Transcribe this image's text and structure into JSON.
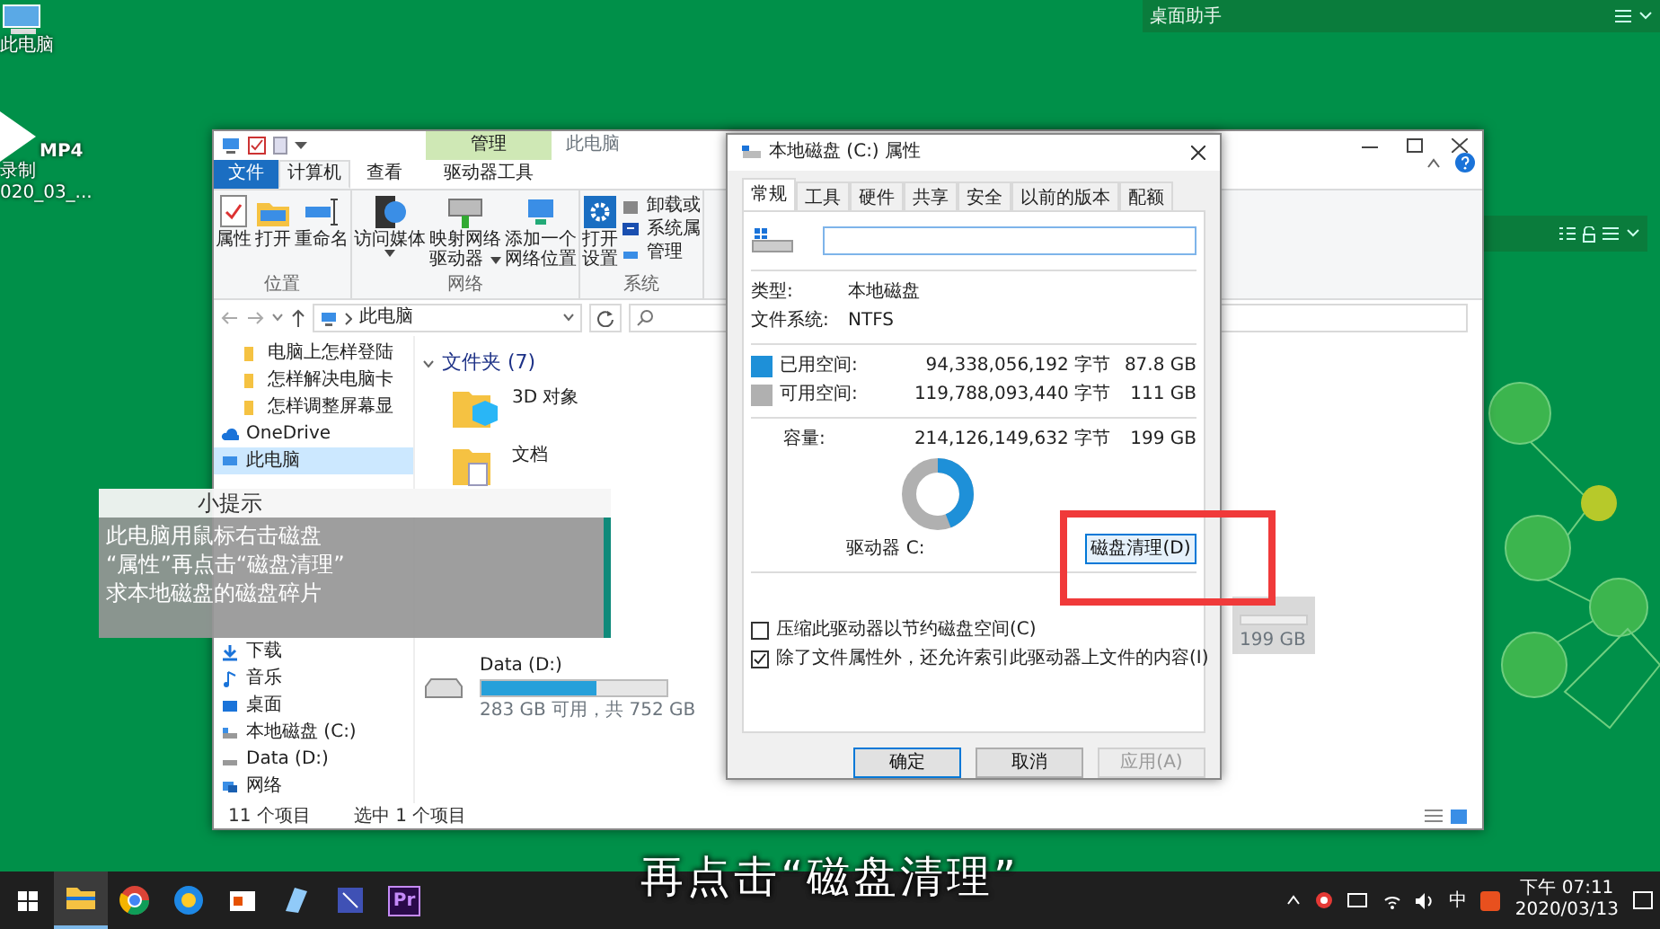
{
  "desktop": {
    "icons": [
      {
        "kind": "pc",
        "lines": [
          "此电脑"
        ]
      },
      {
        "kind": "video",
        "badge": "MP4",
        "lines": [
          "录制",
          "020_03_..."
        ]
      }
    ],
    "helper_bars": [
      {
        "kind": "titled",
        "title": "桌面助手"
      },
      {
        "kind": "tools"
      }
    ]
  },
  "explorer": {
    "title": "此电脑",
    "context_tab": "管理",
    "tabs": [
      {
        "label": "文件",
        "kind": "file",
        "selected": false
      },
      {
        "label": "计算机",
        "kind": "tab",
        "selected": true
      },
      {
        "label": "查看",
        "kind": "tab",
        "selected": false
      },
      {
        "label": "驱动器工具",
        "kind": "tab",
        "selected": false
      }
    ],
    "ribbon": [
      {
        "name": "位置",
        "buttons": [
          {
            "kind": "properties",
            "lines": [
              "属性"
            ],
            "dropdown": false
          },
          {
            "kind": "open",
            "lines": [
              "打开"
            ],
            "dropdown": false
          },
          {
            "kind": "rename",
            "lines": [
              "重命名"
            ],
            "dropdown": false
          }
        ]
      },
      {
        "name": "网络",
        "buttons": [
          {
            "kind": "media",
            "lines": [
              "访问媒体"
            ],
            "dropdown": true
          },
          {
            "kind": "map",
            "lines": [
              "映射网络",
              "驱动器"
            ],
            "dropdown": true
          },
          {
            "kind": "netloc",
            "lines": [
              "添加一个",
              "网络位置"
            ],
            "dropdown": false
          }
        ]
      },
      {
        "name": "系统",
        "buttons": [
          {
            "kind": "settings",
            "lines": [
              "打开",
              "设置"
            ],
            "dropdown": false
          }
        ],
        "small": [
          {
            "kind": "uninstall",
            "label": "卸载或"
          },
          {
            "kind": "sysprops",
            "label": "系统属"
          },
          {
            "kind": "manage",
            "label": "管理"
          }
        ]
      }
    ],
    "address": {
      "path": "此电脑"
    },
    "nav_top": [
      {
        "kind": "folder",
        "label": "电脑上怎样登陆",
        "selected": false
      },
      {
        "kind": "folder",
        "label": "怎样解决电脑卡",
        "selected": false
      },
      {
        "kind": "folder",
        "label": "怎样调整屏幕显",
        "selected": false
      },
      {
        "kind": "onedrive",
        "label": "OneDrive",
        "selected": false
      },
      {
        "kind": "pc",
        "label": "此电脑",
        "selected": true
      }
    ],
    "nav_bottom": [
      {
        "kind": "download",
        "label": "下载",
        "selected": false
      },
      {
        "kind": "music",
        "label": "音乐",
        "selected": false
      },
      {
        "kind": "desktop",
        "label": "桌面",
        "selected": false
      },
      {
        "kind": "cdrive",
        "label": "本地磁盘 (C:)",
        "selected": false
      },
      {
        "kind": "ddrive",
        "label": "Data (D:)",
        "selected": false
      },
      {
        "kind": "network",
        "label": "网络",
        "selected": false
      }
    ],
    "folders": {
      "title": "文件夹 (7)",
      "items": [
        {
          "kind": "objects",
          "name": "3D 对象"
        },
        {
          "kind": "documents",
          "name": "文档"
        }
      ]
    },
    "drive": {
      "name": "Data (D:)",
      "level": 0.62,
      "caption": "283 GB 可用，共 752 GB"
    },
    "selected_tile": {
      "caption": "199 GB",
      "selected": true
    },
    "status": [
      "11 个项目",
      "选中 1 个项目"
    ]
  },
  "dialog": {
    "title": "本地磁盘 (C:) 属性",
    "tabs": [
      {
        "label": "常规",
        "selected": true
      },
      {
        "label": "工具",
        "selected": false
      },
      {
        "label": "硬件",
        "selected": false
      },
      {
        "label": "共享",
        "selected": false
      },
      {
        "label": "安全",
        "selected": false
      },
      {
        "label": "以前的版本",
        "selected": false
      },
      {
        "label": "配额",
        "selected": false
      }
    ],
    "info": [
      {
        "label": "类型:",
        "value": "本地磁盘"
      },
      {
        "label": "文件系统:",
        "value": "NTFS"
      }
    ],
    "space": [
      {
        "label": "已用空间:",
        "color": "#1e90d8",
        "bytes": "94,338,056,192 字节",
        "size": "87.8 GB"
      },
      {
        "label": "可用空间:",
        "color": "#b0b0b0",
        "bytes": "119,788,093,440 字节",
        "size": "111 GB"
      }
    ],
    "capacity": {
      "label": "容量:",
      "bytes": "214,126,149,632 字节",
      "size": "199 GB"
    },
    "donut": {
      "level": 0.44
    },
    "drive_label": "驱动器 C:",
    "cleanup_button": "磁盘清理(D)",
    "checkboxes": [
      {
        "label": "压缩此驱动器以节约磁盘空间(C)",
        "checked": false
      },
      {
        "label": "除了文件属性外，还允许索引此驱动器上文件的内容(I)",
        "checked": true
      }
    ],
    "buttons": [
      {
        "label": "确定",
        "disabled": false,
        "default": true
      },
      {
        "label": "取消",
        "disabled": false,
        "default": false
      },
      {
        "label": "应用(A)",
        "disabled": true,
        "default": false
      }
    ]
  },
  "tip": {
    "title": "小提示",
    "lines": [
      "此电脑用鼠标右击磁盘",
      "“属性”再点击“磁盘清理”",
      "求本地磁盘的磁盘碎片"
    ]
  },
  "subtitle": "再点击“磁盘清理”",
  "taskbar": {
    "apps": [
      {
        "kind": "explorer",
        "active": true
      },
      {
        "kind": "chrome",
        "active": false
      },
      {
        "kind": "browser",
        "active": false
      },
      {
        "kind": "office",
        "active": false
      },
      {
        "kind": "notes",
        "active": false
      },
      {
        "kind": "video",
        "active": false
      },
      {
        "kind": "premiere",
        "label": "Pr",
        "active": false
      }
    ],
    "ime": "中",
    "time": "下午 07:11",
    "date": "2020/03/13"
  }
}
